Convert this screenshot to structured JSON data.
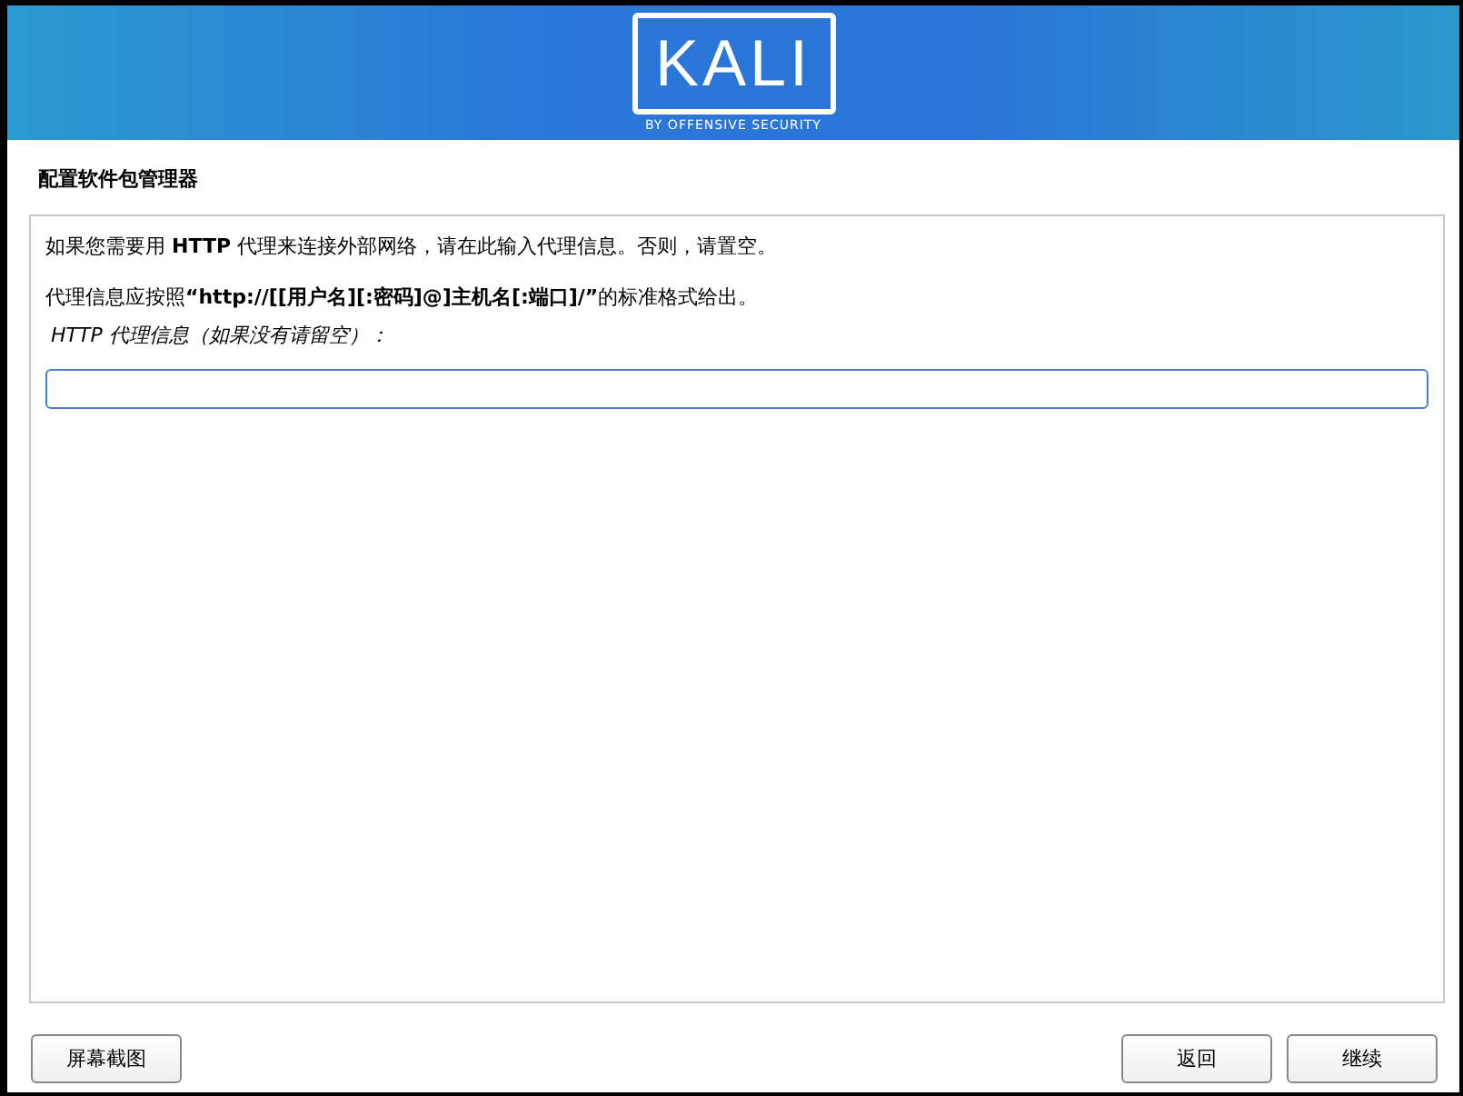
{
  "banner": {
    "logo": "KALI",
    "tagline": "BY OFFENSIVE SECURITY"
  },
  "page_title": "配置软件包管理器",
  "paragraphs": [
    "如果您需要用 **HTTP** 代理来连接外部网络，请在此输入代理信息。否则，请置空。",
    "代理信息应按照**“http://[[用户名][:密码]@]主机名[:端口]/”**的标准格式给出。"
  ],
  "field": {
    "label": "HTTP 代理信息（如果没有请留空）：",
    "focused": true
  },
  "left_buttons": [
    "屏幕截图"
  ],
  "right_buttons": [
    "返回",
    "继续"
  ]
}
